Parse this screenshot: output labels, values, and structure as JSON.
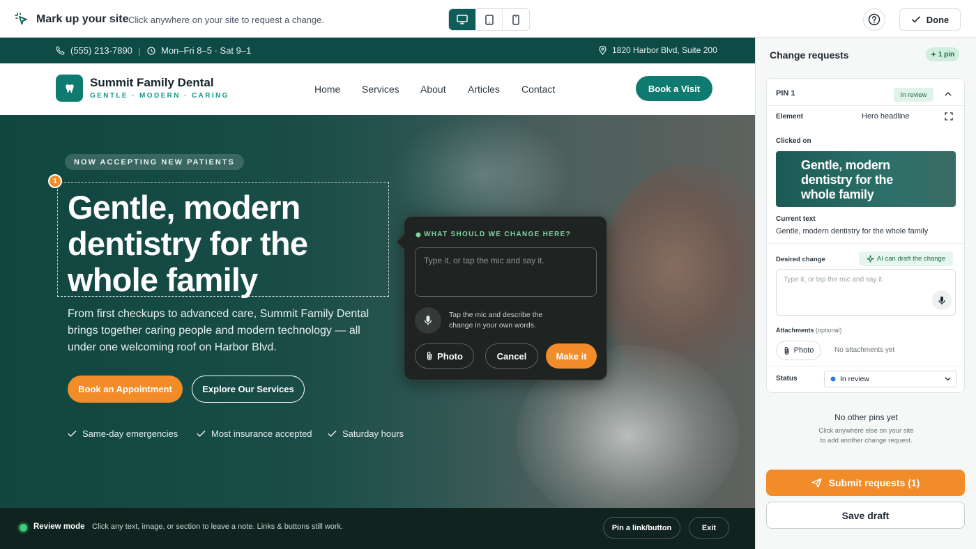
{
  "toolbar": {
    "title": "Mark up your site",
    "hint": "Click anywhere on your site to request a change.",
    "devices": [
      {
        "name": "desktop-icon",
        "active": true
      },
      {
        "name": "tablet-icon",
        "active": false
      },
      {
        "name": "phone-icon",
        "active": false
      }
    ],
    "help_icon": "question-circle-icon",
    "done_label": "Done"
  },
  "site": {
    "phone": "(555) 213-7890",
    "hours": "Mon–Fri 8–5 · Sat 9–1",
    "address": "1820 Harbor Blvd, Suite 200",
    "brand_name": "Summit Family Dental",
    "brand_tagline": "GENTLE · MODERN · CARING",
    "nav": [
      "Home",
      "Services",
      "About",
      "Articles",
      "Contact"
    ],
    "book_label": "Book a Visit",
    "eyebrow": "NOW ACCEPTING NEW PATIENTS",
    "pin_number": "1",
    "headline": "Gentle, modern dentistry for the whole family",
    "subheadline": "From first checkups to advanced care, Summit Family Dental brings together caring people and modern technology — all under one welcoming roof on Harbor Blvd.",
    "cta_primary": "Book an Appointment",
    "cta_secondary": "Explore Our Services",
    "perks": [
      "Same-day emergencies",
      "Most insurance accepted",
      "Saturday hours"
    ]
  },
  "popup": {
    "title": "WHAT SHOULD WE CHANGE HERE?",
    "placeholder": "Type it, or tap the mic and say it.",
    "mic_hint": "Tap the mic and describe the change in your own words.",
    "photo_label": "Photo",
    "cancel_label": "Cancel",
    "make_label": "Make it"
  },
  "review_bar": {
    "label": "Review mode",
    "text": "Click any text, image, or section to leave a note. Links & buttons still work.",
    "pin_link_label": "Pin a link/button",
    "exit_label": "Exit"
  },
  "panel": {
    "title": "Change requests",
    "pin_count": "1 pin",
    "pin": {
      "label": "PIN 1",
      "status_badge": "In review",
      "element_key": "Element",
      "element_value": "Hero headline",
      "clicked_on_key": "Clicked on",
      "thumb_text": "Gentle, modern dentistry for the whole family",
      "current_text_key": "Current text",
      "current_text_value": "Gentle, modern dentistry for the whole family",
      "desired_change_key": "Desired change",
      "ai_draft_label": "AI can draft the change",
      "desired_placeholder": "Type it, or tap the mic and say it.",
      "attachments_key": "Attachments",
      "attachments_optional": "(optional)",
      "photo_label": "Photo",
      "no_attachments": "No attachments yet",
      "status_key": "Status",
      "status_value": "In review"
    },
    "no_other_title": "No other pins yet",
    "no_other_line1": "Click anywhere else on your site",
    "no_other_line2": "to add another change request.",
    "submit_label": "Submit requests (1)",
    "save_draft_label": "Save draft"
  },
  "colors": {
    "brand_teal": "#0f7a70",
    "accent_orange": "#f28c28",
    "infobar": "#0e4a46",
    "review_green": "#3ecf7a"
  }
}
